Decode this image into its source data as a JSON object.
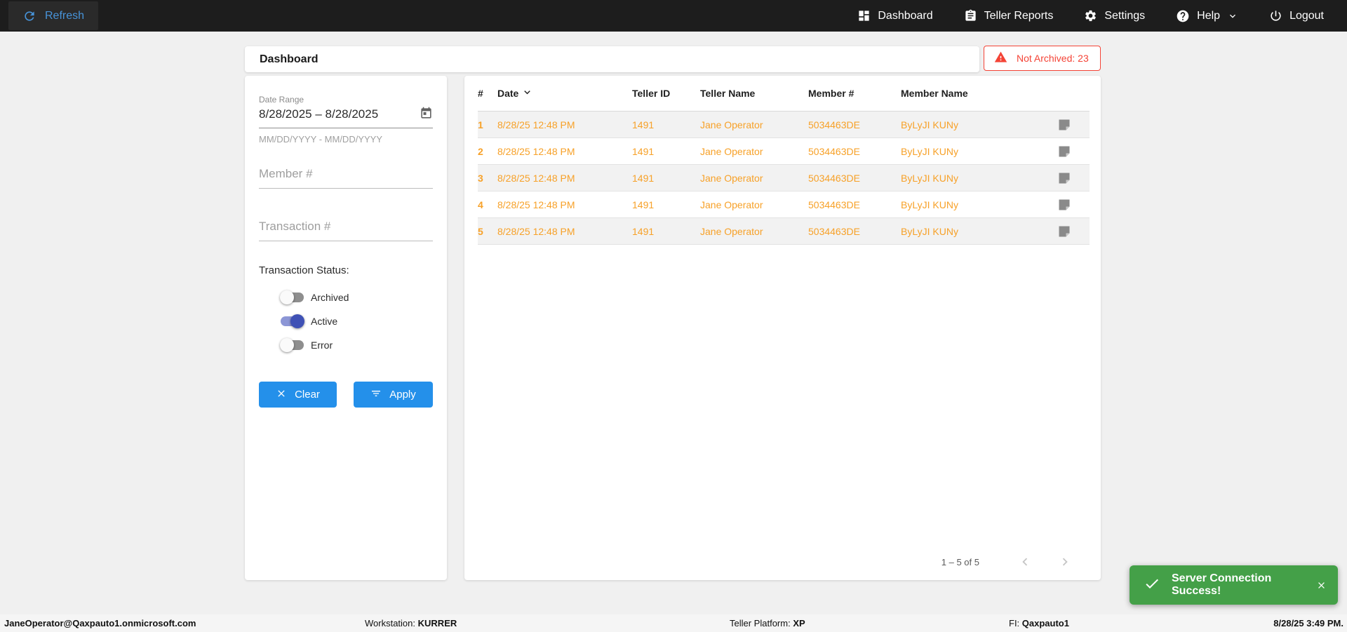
{
  "topnav": {
    "refresh_label": "Refresh",
    "dashboard_label": "Dashboard",
    "teller_reports_label": "Teller Reports",
    "settings_label": "Settings",
    "help_label": "Help",
    "logout_label": "Logout"
  },
  "header": {
    "title": "Dashboard",
    "not_archived_label": "Not Archived: 23"
  },
  "filters": {
    "date_range": {
      "label": "Date Range",
      "value": "8/28/2025 – 8/28/2025",
      "helper": "MM/DD/YYYY - MM/DD/YYYY"
    },
    "member_placeholder": "Member #",
    "transaction_placeholder": "Transaction #",
    "status_label": "Transaction Status:",
    "toggles": [
      {
        "label": "Archived",
        "on": false
      },
      {
        "label": "Active",
        "on": true
      },
      {
        "label": "Error",
        "on": false
      }
    ],
    "clear_label": "Clear",
    "apply_label": "Apply"
  },
  "table": {
    "columns": {
      "num": "#",
      "date": "Date",
      "teller_id": "Teller ID",
      "teller_name": "Teller Name",
      "member_num": "Member #",
      "member_name": "Member Name"
    },
    "sorted_by": "Date",
    "rows": [
      {
        "num": "1",
        "date": "8/28/25 12:48 PM",
        "teller_id": "1491",
        "teller_name": "Jane Operator",
        "member_num": "5034463DE",
        "member_name": "ByLyJI KUNy"
      },
      {
        "num": "2",
        "date": "8/28/25 12:48 PM",
        "teller_id": "1491",
        "teller_name": "Jane Operator",
        "member_num": "5034463DE",
        "member_name": "ByLyJI KUNy"
      },
      {
        "num": "3",
        "date": "8/28/25 12:48 PM",
        "teller_id": "1491",
        "teller_name": "Jane Operator",
        "member_num": "5034463DE",
        "member_name": "ByLyJI KUNy"
      },
      {
        "num": "4",
        "date": "8/28/25 12:48 PM",
        "teller_id": "1491",
        "teller_name": "Jane Operator",
        "member_num": "5034463DE",
        "member_name": "ByLyJI KUNy"
      },
      {
        "num": "5",
        "date": "8/28/25 12:48 PM",
        "teller_id": "1491",
        "teller_name": "Jane Operator",
        "member_num": "5034463DE",
        "member_name": "ByLyJI KUNy"
      }
    ],
    "pagination_label": "1 – 5 of 5"
  },
  "toast": {
    "message": "Server Connection Success!"
  },
  "statusbar": {
    "user": "JaneOperator@Qaxpauto1.onmicrosoft.com",
    "workstation_label": "Workstation:",
    "workstation_value": "KURRER",
    "platform_label": "Teller Platform:",
    "platform_value": "XP",
    "fi_label": "FI:",
    "fi_value": "Qaxpauto1",
    "datetime": "8/28/25 3:49 PM."
  },
  "colors": {
    "nav_bg": "#1d1d1d",
    "nav_link_blue": "#4793d9",
    "accent_blue": "#2490ea",
    "row_orange": "#f7a128",
    "alert_red": "#f44336",
    "toast_green": "#44a048",
    "toggle_indigo": "#3f51b5"
  }
}
